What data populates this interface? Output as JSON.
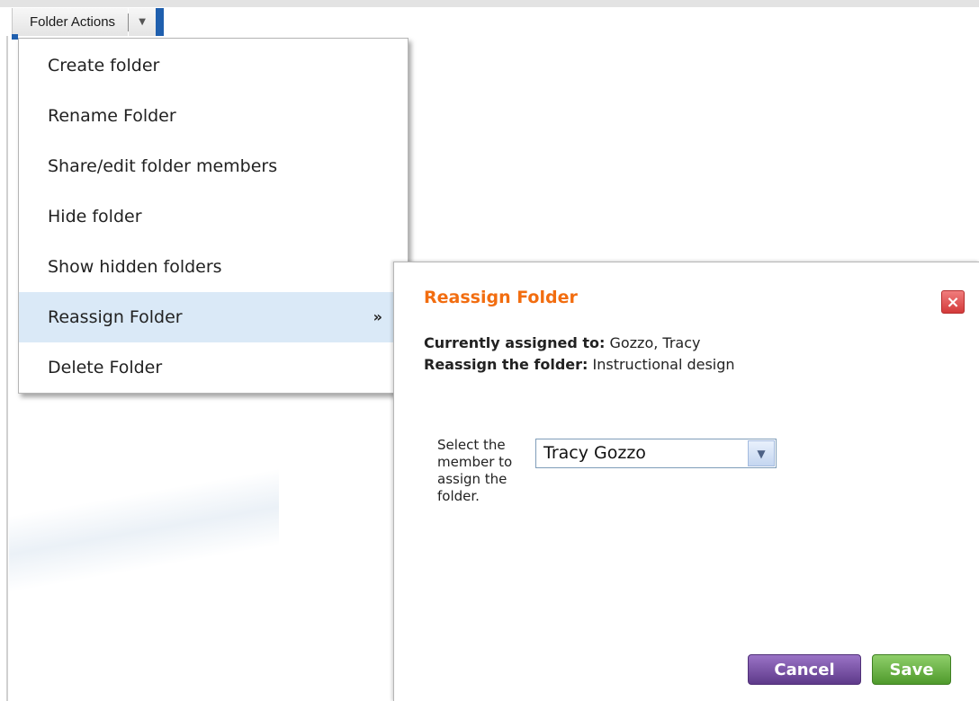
{
  "toolbar": {
    "folder_actions_label": "Folder Actions",
    "dropdown_icon": "caret-down-icon"
  },
  "menu": {
    "items": [
      {
        "label": "Create folder"
      },
      {
        "label": "Rename Folder"
      },
      {
        "label": "Share/edit folder members"
      },
      {
        "label": "Hide folder"
      },
      {
        "label": "Show hidden folders"
      },
      {
        "label": "Reassign Folder",
        "submenu_indicator": "»",
        "active": true
      },
      {
        "label": "Delete Folder"
      }
    ]
  },
  "dialog": {
    "title": "Reassign Folder",
    "close_symbol": "×",
    "currently_assigned_label": "Currently assigned to:",
    "currently_assigned_value": "Gozzo, Tracy",
    "reassign_label": "Reassign the folder:",
    "reassign_value": "Instructional design",
    "select_label": "Select the member to assign the folder.",
    "select_value": "Tracy Gozzo",
    "cancel_label": "Cancel",
    "save_label": "Save"
  },
  "colors": {
    "title_orange": "#f26d10",
    "menu_highlight": "#dae9f7",
    "cancel_purple": "#6b4596",
    "save_green": "#5fab36",
    "close_red": "#d9463f",
    "toolbar_blue": "#1f5fae"
  }
}
